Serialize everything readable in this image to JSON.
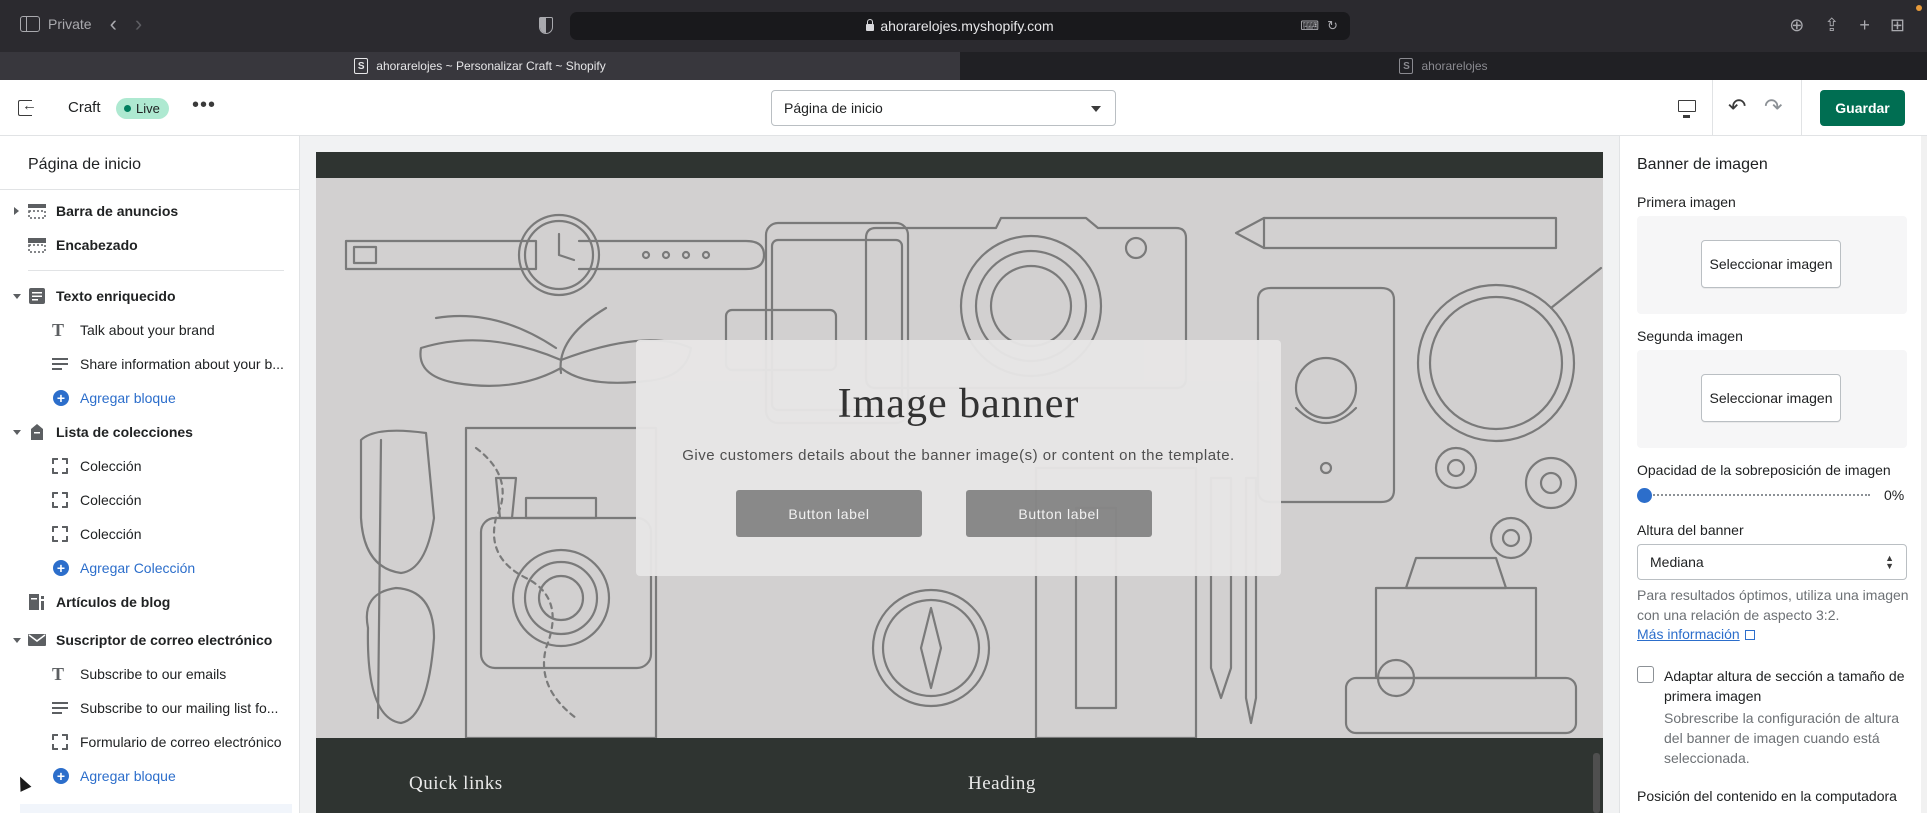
{
  "browser": {
    "mode_label": "Private",
    "url": "ahorarelojes.myshopify.com",
    "tabs": [
      {
        "label": "ahorarelojes ~ Personalizar Craft ~ Shopify"
      },
      {
        "label": "ahorarelojes"
      }
    ]
  },
  "editor": {
    "theme_name": "Craft",
    "live_badge": "Live",
    "page_select": "Página de inicio",
    "save_label": "Guardar"
  },
  "sidebar": {
    "title": "Página de inicio",
    "items": [
      {
        "label": "Barra de anuncios"
      },
      {
        "label": "Encabezado"
      },
      {
        "label": "Texto enriquecido"
      },
      {
        "label": "Talk about your brand"
      },
      {
        "label": "Share information about your b..."
      },
      {
        "label": "Agregar bloque"
      },
      {
        "label": "Lista de colecciones"
      },
      {
        "label": "Colección"
      },
      {
        "label": "Colección"
      },
      {
        "label": "Colección"
      },
      {
        "label": "Agregar Colección"
      },
      {
        "label": "Artículos de blog"
      },
      {
        "label": "Suscriptor de correo electrónico"
      },
      {
        "label": "Subscribe to our emails"
      },
      {
        "label": "Subscribe to our mailing list fo..."
      },
      {
        "label": "Formulario de correo electrónico"
      },
      {
        "label": "Agregar bloque"
      }
    ]
  },
  "preview": {
    "banner_heading": "Image banner",
    "banner_text": "Give customers details about the banner image(s) or content on the template.",
    "button1": "Button label",
    "button2": "Button label",
    "footer_heading1": "Quick links",
    "footer_heading2": "Heading"
  },
  "settings": {
    "title": "Banner de imagen",
    "first_image_label": "Primera imagen",
    "second_image_label": "Segunda imagen",
    "select_image_label": "Seleccionar imagen",
    "opacity_label": "Opacidad de la sobreposición de imagen",
    "opacity_value": "0%",
    "opacity_fraction": 0,
    "height_label": "Altura del banner",
    "height_value": "Mediana",
    "help_text": "Para resultados óptimos, utiliza una imagen con una relación de aspecto 3:2.",
    "help_link": "Más información",
    "adapt_label": "Adaptar altura de sección a tamaño de primera imagen",
    "adapt_help": "Sobrescribe la configuración de altura del banner de imagen cuando está seleccionada.",
    "position_label": "Posición del contenido en la computadora"
  },
  "colors": {
    "save_button": "#006e52",
    "live_badge": "#aee9d1",
    "link": "#2c6ecb",
    "site_dark": "#2f3431"
  }
}
